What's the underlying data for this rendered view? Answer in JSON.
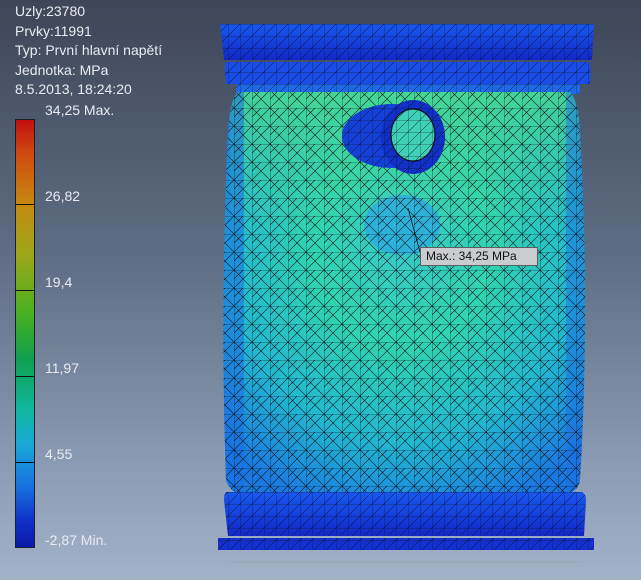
{
  "info": {
    "nodes": "Uzly:23780",
    "elements": "Prvky:11991",
    "type": "Typ: První hlavní napětí",
    "unit": "Jednotka: MPa",
    "date": "8.5.2013, 18:24:20"
  },
  "scale": {
    "labels": [
      "34,25 Max.",
      "26,82",
      "19,4",
      "11,97",
      "4,55",
      "-2,87 Min."
    ],
    "max": 34.25,
    "min": -2.87
  },
  "probe": {
    "label": "Max.: 34,25 MPa"
  },
  "colors": {
    "mesh_high": "#3cc8b0",
    "mesh_mid": "#20b8d8",
    "mesh_low": "#1840e0",
    "background_top": "#3d4657",
    "background_bottom": "#a3b2c7"
  }
}
